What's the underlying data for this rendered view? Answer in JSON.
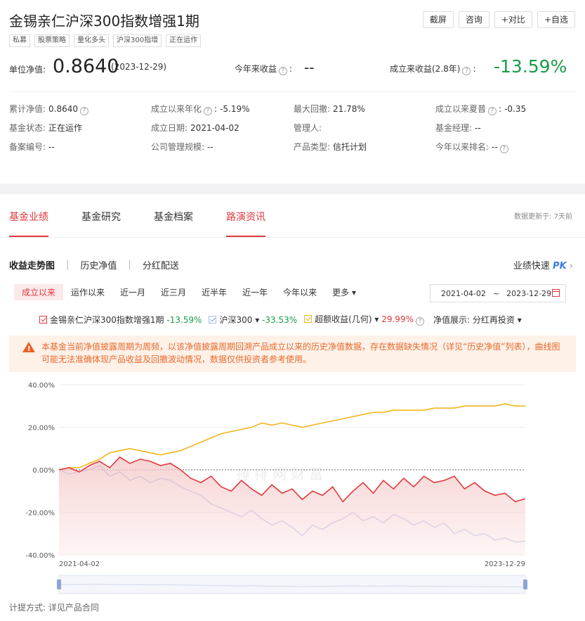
{
  "header": {
    "title": "金锡亲仁沪深300指数增强1期",
    "tags": [
      "私募",
      "股票策略",
      "量化多头",
      "沪深300指增",
      "正在运作"
    ],
    "buttons": [
      "截屏",
      "咨询",
      "+对比",
      "+自选"
    ]
  },
  "nav": {
    "label": "单位净值:",
    "value": "0.8640",
    "date": "(2023-12-29)",
    "ytd_label": "今年来收益",
    "ytd_value": "--",
    "since_label": "成立来收益(2.8年)",
    "since_value": "-13.59%"
  },
  "info": [
    {
      "k": "累计净值:",
      "v": "0.8640",
      "q": true
    },
    {
      "k": "成立以来年化",
      "v": "-5.19%",
      "q": true
    },
    {
      "k": "最大回撤:",
      "v": "21.78%",
      "q": false
    },
    {
      "k": "成立以来夏普",
      "v": "-0.35",
      "q": true
    },
    {
      "k": "基金状态:",
      "v": "正在运作",
      "q": false
    },
    {
      "k": "成立日期:",
      "v": "2021-04-02",
      "q": false
    },
    {
      "k": "管理人:",
      "v": "",
      "q": false
    },
    {
      "k": "基金经理:",
      "v": "--",
      "q": false
    },
    {
      "k": "备案编号:",
      "v": "--",
      "q": false
    },
    {
      "k": "公司管理规模:",
      "v": "--",
      "q": false
    },
    {
      "k": "产品类型:",
      "v": "信托计划",
      "q": false
    },
    {
      "k": "今年以来排名:",
      "v": "--",
      "q": true
    }
  ],
  "tabs": [
    "基金业绩",
    "基金研究",
    "基金档案",
    "路演资讯"
  ],
  "updated": "数据更新于:  7天前",
  "subtabs": [
    "收益走势图",
    "历史净值",
    "分红配送"
  ],
  "pk_label": "业绩快速",
  "pk_badge": "PK",
  "ranges": [
    "成立以来",
    "运作以来",
    "近一月",
    "近三月",
    "近半年",
    "近一年",
    "今年以来",
    "更多"
  ],
  "date_from": "2021-04-02",
  "date_sep": "~",
  "date_to": "2023-12-29",
  "legend": {
    "fund_name": "金锡亲仁沪深300指数增强1期",
    "fund_val": "-13.59%",
    "idx_name": "沪深300",
    "idx_val": "-33.53%",
    "excess_name": "超额收益(几何)",
    "excess_val": "29.99%",
    "display_label": "净值展示:",
    "display_value": "分红再投资"
  },
  "warning": "本基金当前净值披露周期为周频，以该净值披露周期回溯产品成立以来的历史净值数据，存在数据缺失情况（详见“历史净值”列表），曲线图可能无法准确体现产品收益及回撤波动情况，数据仅供投资者参考使用。",
  "watermark": "排排网财富",
  "footer": "计提方式: 详见产品合同",
  "colors": {
    "fund": "#e0393e",
    "index": "#a8bde8",
    "excess": "#f2b51b",
    "accent": "#e0393e"
  },
  "chart_data": {
    "type": "line",
    "x_start": "2021-04-02",
    "x_end": "2023-12-29",
    "x_labels": [
      "2021-04-02",
      "2023-12-29"
    ],
    "y_ticks": [
      "40.00%",
      "20.00%",
      "0.00%",
      "-20.00%",
      "-40.00%"
    ],
    "ylim": [
      -40,
      40
    ],
    "series": [
      {
        "name": "金锡亲仁沪深300指数增强1期",
        "color": "#e0393e",
        "values": [
          0,
          1,
          -1,
          2,
          4,
          1,
          6,
          3,
          5,
          4,
          2,
          3,
          0,
          -4,
          -6,
          -3,
          -8,
          -10,
          -5,
          -9,
          -12,
          -7,
          -11,
          -9,
          -14,
          -10,
          -12,
          -8,
          -15,
          -10,
          -6,
          -11,
          -5,
          -9,
          -4,
          -8,
          -3,
          -6,
          -5,
          -3,
          -9,
          -6,
          -10,
          -12,
          -11,
          -15,
          -13.59
        ]
      },
      {
        "name": "沪深300",
        "color": "#a8bde8",
        "values": [
          0,
          -2,
          -1,
          0,
          2,
          -3,
          -1,
          -5,
          -3,
          -6,
          -4,
          -5,
          -8,
          -10,
          -12,
          -16,
          -18,
          -20,
          -22,
          -19,
          -23,
          -26,
          -24,
          -27,
          -31,
          -26,
          -28,
          -25,
          -23,
          -20,
          -24,
          -22,
          -25,
          -21,
          -23,
          -26,
          -24,
          -27,
          -25,
          -30,
          -28,
          -31,
          -30,
          -33,
          -32,
          -34,
          -33.53
        ]
      },
      {
        "name": "超额收益(几何)",
        "color": "#f2b51b",
        "values": [
          0,
          1,
          1,
          3,
          5,
          8,
          9,
          10,
          9,
          8,
          7,
          8,
          9,
          11,
          13,
          15,
          17,
          18,
          19,
          20,
          22,
          21,
          22,
          21,
          20,
          21,
          22,
          23,
          24,
          25,
          26,
          27,
          27,
          28,
          28,
          28,
          28,
          29,
          29,
          29,
          30,
          30,
          30,
          30,
          31,
          30,
          29.99
        ]
      }
    ]
  }
}
